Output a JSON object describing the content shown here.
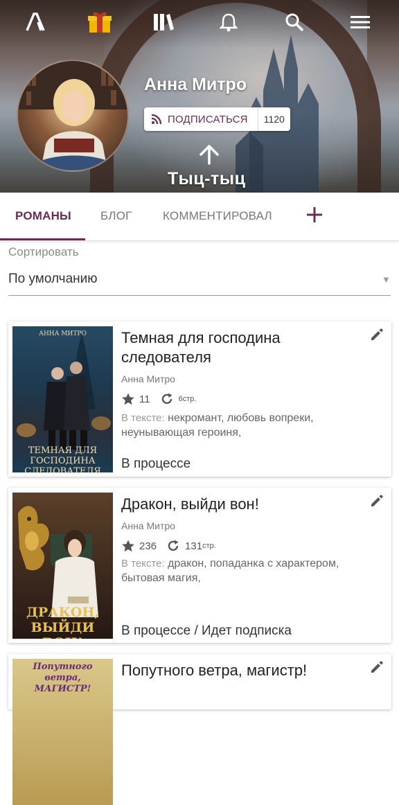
{
  "header": {
    "author_name": "Анна Митро",
    "subscribe_label": "ПОДПИСАТЬСЯ",
    "subscribers_count": "1120",
    "tap_label": "Тыц-тыц"
  },
  "topnav": {
    "icons": [
      "logo-icon",
      "gift-icon",
      "library-icon",
      "bell-icon",
      "search-icon",
      "menu-icon"
    ]
  },
  "tabs": {
    "items": [
      "РОМАНЫ",
      "БЛОГ",
      "КОММЕНТИРОВАЛ"
    ],
    "active": "РОМАНЫ"
  },
  "sort": {
    "label": "Сортировать",
    "value": "По умолчанию"
  },
  "books": [
    {
      "title": "Темная для господина следователя",
      "author": "Анна Митро",
      "rating": "11",
      "pages": "6",
      "pages_unit": "стр.",
      "tags_label": "В тексте:",
      "tags": "некромант, любовь вопреки, неунывающая героиня,",
      "status": "В процессе",
      "cover_top": "АННА МИТРО",
      "cover_bottom": "ТЕМНАЯ ДЛЯ ГОСПОДИНА СЛЕДОВАТЕЛЯ"
    },
    {
      "title": "Дракон, выйди вон!",
      "author": "Анна Митро",
      "rating": "236",
      "pages": "131",
      "pages_unit": "стр.",
      "tags_label": "В тексте:",
      "tags": "дракон, попаданка с характером, бытовая магия,",
      "status": "В процессе / Идет подписка",
      "cover_top": "",
      "cover_bottom": "ДРАКОН, ВЫЙДИ ВОН!"
    },
    {
      "title": "Попутного ветра, магистр!",
      "cover_top": "Попутного ветра, МАГИСТР!"
    }
  ],
  "colors": {
    "accent": "#6d2a55"
  }
}
